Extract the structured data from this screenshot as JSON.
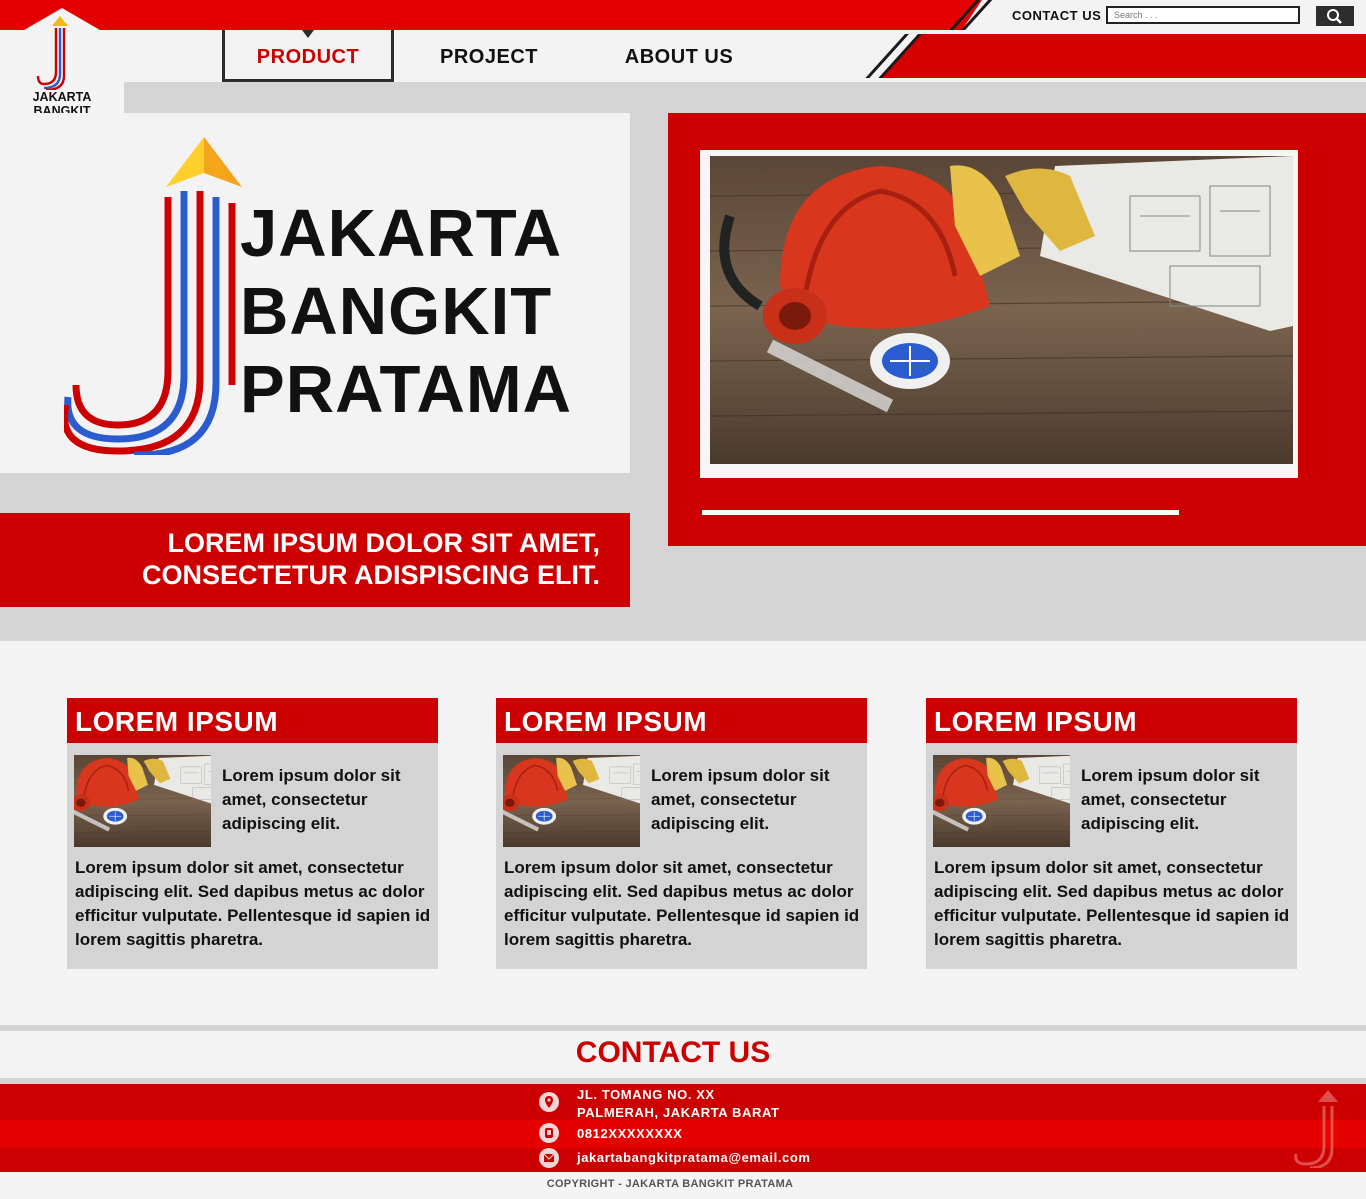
{
  "brand": {
    "name_lines": [
      "JAKARTA",
      "BANGKIT",
      "PRATAMA"
    ],
    "colors": {
      "red": "#cc0000",
      "bright_red": "#e50000",
      "blue": "#2a5ccf",
      "gold": "#f5b81b"
    }
  },
  "header": {
    "contact_label": "CONTACT US",
    "search_placeholder": "Search . . .",
    "search_icon": "magnifier-icon"
  },
  "nav": {
    "items": [
      {
        "label": "PRODUCT",
        "active": true
      },
      {
        "label": "PROJECT",
        "active": false
      },
      {
        "label": "ABOUT US",
        "active": false
      }
    ]
  },
  "hero": {
    "tagline_lines": [
      "LOREM IPSUM DOLOR SIT AMET,",
      "CONSECTETUR ADISPISCING ELIT."
    ],
    "photo": "safety-equipment-on-wooden-table"
  },
  "cards": [
    {
      "title": "LOREM IPSUM",
      "intro": "Lorem ipsum dolor sit amet, consectetur adipiscing elit.",
      "body": "Lorem ipsum dolor sit amet, consectetur adipiscing elit. Sed dapibus metus ac dolor efficitur vulputate. Pellentesque id sapien id lorem sagittis pharetra."
    },
    {
      "title": "LOREM IPSUM",
      "intro": "Lorem ipsum dolor sit amet, consectetur adipiscing elit.",
      "body": "Lorem ipsum dolor sit amet, consectetur adipiscing elit. Sed dapibus metus ac dolor efficitur vulputate. Pellentesque id sapien id lorem sagittis pharetra."
    },
    {
      "title": "LOREM IPSUM",
      "intro": "Lorem ipsum dolor sit amet, consectetur adipiscing elit.",
      "body": "Lorem ipsum dolor sit amet, consectetur adipiscing elit. Sed dapibus metus ac dolor efficitur vulputate. Pellentesque id sapien id lorem sagittis pharetra."
    }
  ],
  "contact": {
    "title": "CONTACT US",
    "address_lines": [
      "JL. TOMANG NO. XX",
      "PALMERAH, JAKARTA BARAT"
    ],
    "phone": "0812XXXXXXXX",
    "email": "jakartabangkitpratama@email.com",
    "icons": [
      "map-pin-icon",
      "phone-icon",
      "mail-icon"
    ]
  },
  "footer": {
    "copyright": "COPYRIGHT - JAKARTA BANGKIT PRATAMA"
  }
}
